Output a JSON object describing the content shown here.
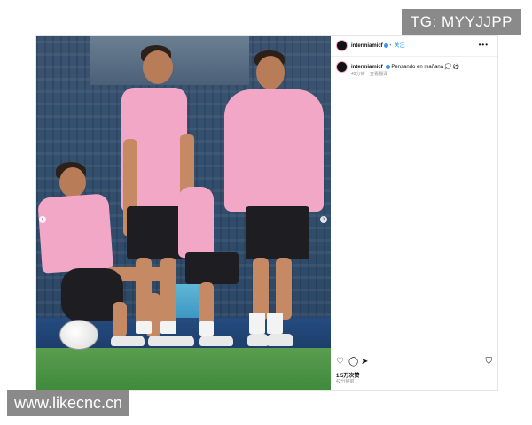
{
  "watermarks": {
    "top_right": "TG: MYYJJPP",
    "bottom_left": "www.likecnc.cn"
  },
  "post": {
    "header": {
      "username": "intermiamicf",
      "follow_label": "关注",
      "more_icon": "ellipsis-icon",
      "more_label": "•••"
    },
    "caption": {
      "username": "intermiamicf",
      "text": "Pensando en mañana 💭 ⚽",
      "time": "42分钟",
      "translate_label": "查看翻译"
    },
    "actions": {
      "like_icon": "heart-icon",
      "comment_icon": "comment-icon",
      "share_icon": "send-icon",
      "save_icon": "bookmark-icon"
    },
    "likes": "1.5万次赞",
    "time": "42分钟前",
    "photo": {
      "prev_icon": "chevron-left-icon",
      "next_icon": "chevron-right-icon"
    }
  },
  "colors": {
    "jersey_pink": "#f2a7c6",
    "link_blue": "#0095f6",
    "verified_blue": "#3897f0"
  }
}
